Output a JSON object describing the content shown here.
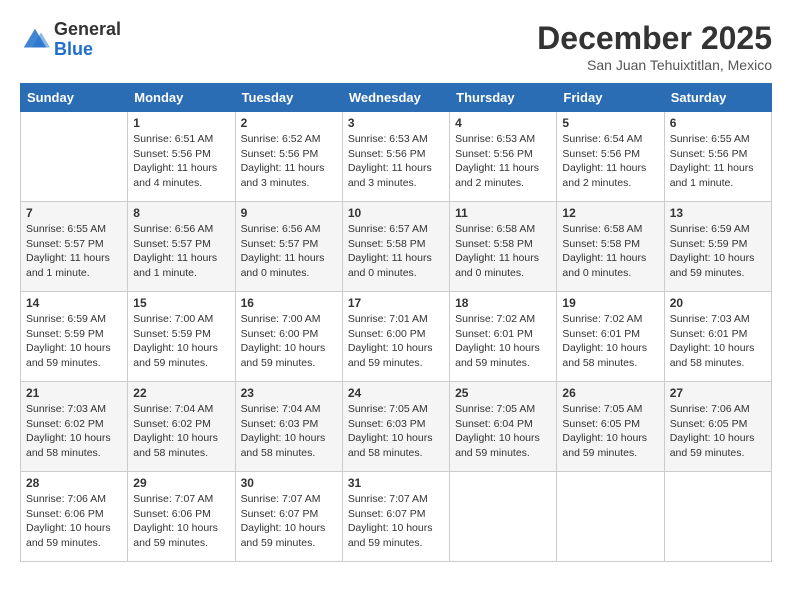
{
  "logo": {
    "general": "General",
    "blue": "Blue"
  },
  "title": "December 2025",
  "subtitle": "San Juan Tehuixtitlan, Mexico",
  "weekdays": [
    "Sunday",
    "Monday",
    "Tuesday",
    "Wednesday",
    "Thursday",
    "Friday",
    "Saturday"
  ],
  "weeks": [
    [
      {
        "day": "",
        "info": ""
      },
      {
        "day": "1",
        "info": "Sunrise: 6:51 AM\nSunset: 5:56 PM\nDaylight: 11 hours\nand 4 minutes."
      },
      {
        "day": "2",
        "info": "Sunrise: 6:52 AM\nSunset: 5:56 PM\nDaylight: 11 hours\nand 3 minutes."
      },
      {
        "day": "3",
        "info": "Sunrise: 6:53 AM\nSunset: 5:56 PM\nDaylight: 11 hours\nand 3 minutes."
      },
      {
        "day": "4",
        "info": "Sunrise: 6:53 AM\nSunset: 5:56 PM\nDaylight: 11 hours\nand 2 minutes."
      },
      {
        "day": "5",
        "info": "Sunrise: 6:54 AM\nSunset: 5:56 PM\nDaylight: 11 hours\nand 2 minutes."
      },
      {
        "day": "6",
        "info": "Sunrise: 6:55 AM\nSunset: 5:56 PM\nDaylight: 11 hours\nand 1 minute."
      }
    ],
    [
      {
        "day": "7",
        "info": "Sunrise: 6:55 AM\nSunset: 5:57 PM\nDaylight: 11 hours\nand 1 minute."
      },
      {
        "day": "8",
        "info": "Sunrise: 6:56 AM\nSunset: 5:57 PM\nDaylight: 11 hours\nand 1 minute."
      },
      {
        "day": "9",
        "info": "Sunrise: 6:56 AM\nSunset: 5:57 PM\nDaylight: 11 hours\nand 0 minutes."
      },
      {
        "day": "10",
        "info": "Sunrise: 6:57 AM\nSunset: 5:58 PM\nDaylight: 11 hours\nand 0 minutes."
      },
      {
        "day": "11",
        "info": "Sunrise: 6:58 AM\nSunset: 5:58 PM\nDaylight: 11 hours\nand 0 minutes."
      },
      {
        "day": "12",
        "info": "Sunrise: 6:58 AM\nSunset: 5:58 PM\nDaylight: 11 hours\nand 0 minutes."
      },
      {
        "day": "13",
        "info": "Sunrise: 6:59 AM\nSunset: 5:59 PM\nDaylight: 10 hours\nand 59 minutes."
      }
    ],
    [
      {
        "day": "14",
        "info": "Sunrise: 6:59 AM\nSunset: 5:59 PM\nDaylight: 10 hours\nand 59 minutes."
      },
      {
        "day": "15",
        "info": "Sunrise: 7:00 AM\nSunset: 5:59 PM\nDaylight: 10 hours\nand 59 minutes."
      },
      {
        "day": "16",
        "info": "Sunrise: 7:00 AM\nSunset: 6:00 PM\nDaylight: 10 hours\nand 59 minutes."
      },
      {
        "day": "17",
        "info": "Sunrise: 7:01 AM\nSunset: 6:00 PM\nDaylight: 10 hours\nand 59 minutes."
      },
      {
        "day": "18",
        "info": "Sunrise: 7:02 AM\nSunset: 6:01 PM\nDaylight: 10 hours\nand 59 minutes."
      },
      {
        "day": "19",
        "info": "Sunrise: 7:02 AM\nSunset: 6:01 PM\nDaylight: 10 hours\nand 58 minutes."
      },
      {
        "day": "20",
        "info": "Sunrise: 7:03 AM\nSunset: 6:01 PM\nDaylight: 10 hours\nand 58 minutes."
      }
    ],
    [
      {
        "day": "21",
        "info": "Sunrise: 7:03 AM\nSunset: 6:02 PM\nDaylight: 10 hours\nand 58 minutes."
      },
      {
        "day": "22",
        "info": "Sunrise: 7:04 AM\nSunset: 6:02 PM\nDaylight: 10 hours\nand 58 minutes."
      },
      {
        "day": "23",
        "info": "Sunrise: 7:04 AM\nSunset: 6:03 PM\nDaylight: 10 hours\nand 58 minutes."
      },
      {
        "day": "24",
        "info": "Sunrise: 7:05 AM\nSunset: 6:03 PM\nDaylight: 10 hours\nand 58 minutes."
      },
      {
        "day": "25",
        "info": "Sunrise: 7:05 AM\nSunset: 6:04 PM\nDaylight: 10 hours\nand 59 minutes."
      },
      {
        "day": "26",
        "info": "Sunrise: 7:05 AM\nSunset: 6:05 PM\nDaylight: 10 hours\nand 59 minutes."
      },
      {
        "day": "27",
        "info": "Sunrise: 7:06 AM\nSunset: 6:05 PM\nDaylight: 10 hours\nand 59 minutes."
      }
    ],
    [
      {
        "day": "28",
        "info": "Sunrise: 7:06 AM\nSunset: 6:06 PM\nDaylight: 10 hours\nand 59 minutes."
      },
      {
        "day": "29",
        "info": "Sunrise: 7:07 AM\nSunset: 6:06 PM\nDaylight: 10 hours\nand 59 minutes."
      },
      {
        "day": "30",
        "info": "Sunrise: 7:07 AM\nSunset: 6:07 PM\nDaylight: 10 hours\nand 59 minutes."
      },
      {
        "day": "31",
        "info": "Sunrise: 7:07 AM\nSunset: 6:07 PM\nDaylight: 10 hours\nand 59 minutes."
      },
      {
        "day": "",
        "info": ""
      },
      {
        "day": "",
        "info": ""
      },
      {
        "day": "",
        "info": ""
      }
    ]
  ]
}
